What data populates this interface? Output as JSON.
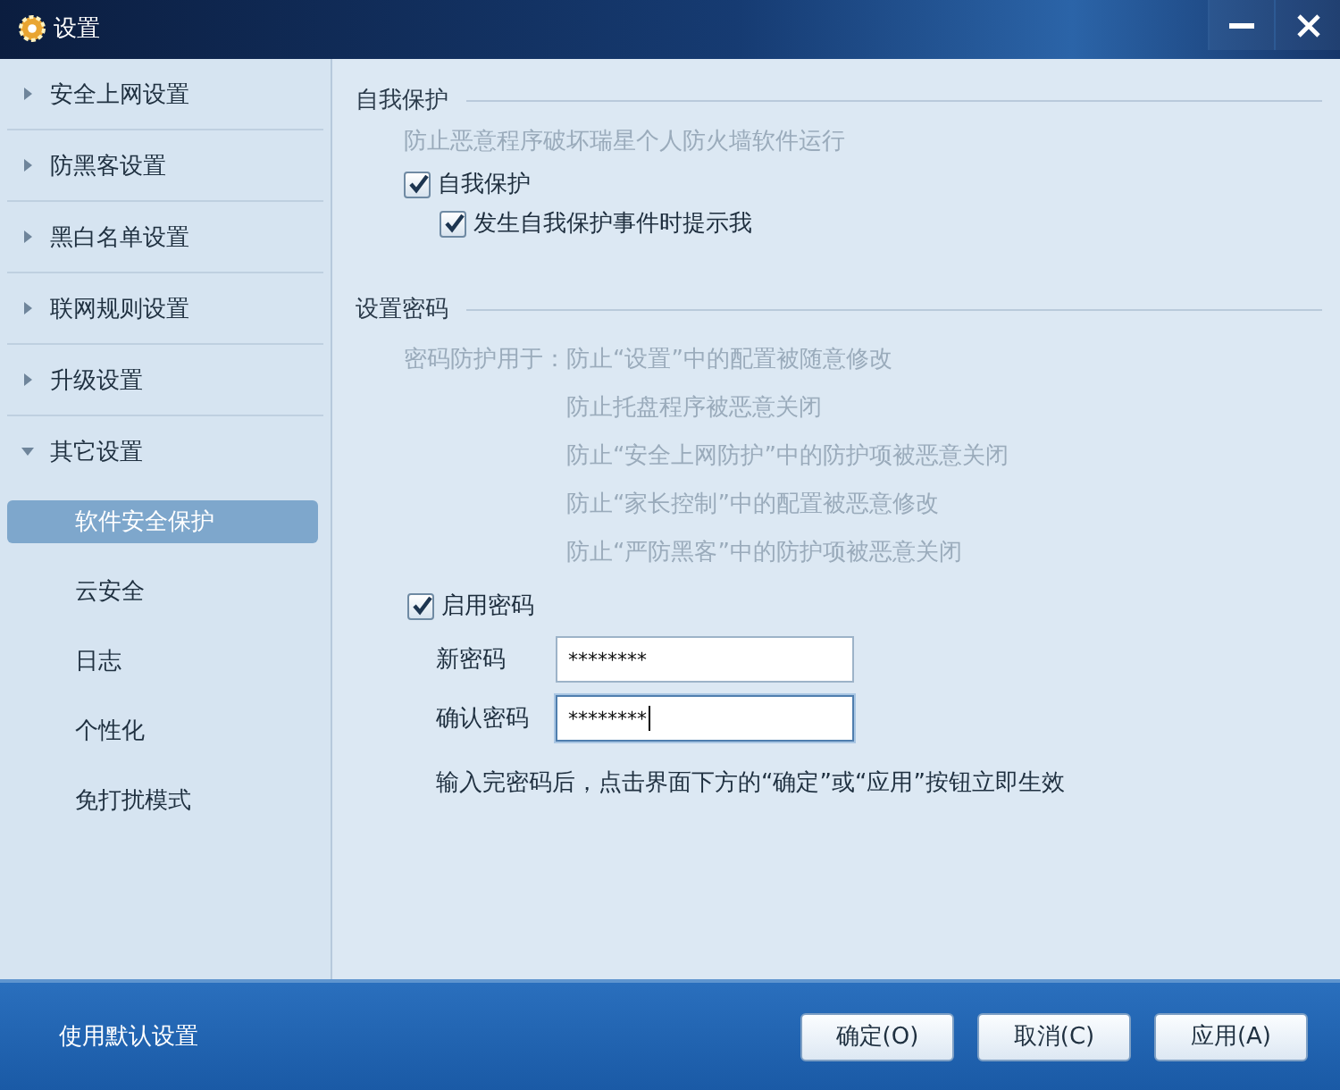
{
  "window": {
    "title": "设置"
  },
  "sidebar": {
    "items": [
      {
        "label": "安全上网设置",
        "expanded": false
      },
      {
        "label": "防黑客设置",
        "expanded": false
      },
      {
        "label": "黑白名单设置",
        "expanded": false
      },
      {
        "label": "联网规则设置",
        "expanded": false
      },
      {
        "label": "升级设置",
        "expanded": false
      },
      {
        "label": "其它设置",
        "expanded": true,
        "children": [
          {
            "label": "软件安全保护",
            "selected": true
          },
          {
            "label": "云安全",
            "selected": false
          },
          {
            "label": "日志",
            "selected": false
          },
          {
            "label": "个性化",
            "selected": false
          },
          {
            "label": "免打扰模式",
            "selected": false
          }
        ]
      }
    ]
  },
  "self_protection": {
    "title": "自我保护",
    "description": "防止恶意程序破坏瑞星个人防火墙软件运行",
    "options": [
      {
        "label": "自我保护",
        "checked": true,
        "children": [
          {
            "label": "发生自我保护事件时提示我",
            "checked": true
          }
        ]
      }
    ]
  },
  "password": {
    "title": "设置密码",
    "lead": "密码防护用于：",
    "uses": [
      "防止“设置”中的配置被随意修改",
      "防止托盘程序被恶意关闭",
      "防止“安全上网防护”中的防护项被恶意关闭",
      "防止“家长控制”中的配置被恶意修改",
      "防止“严防黑客”中的防护项被恶意关闭"
    ],
    "enable": {
      "label": "启用密码",
      "checked": true
    },
    "fields": [
      {
        "label": "新密码",
        "value": "********",
        "focused": false
      },
      {
        "label": "确认密码",
        "value": "********",
        "focused": true
      }
    ],
    "note": "输入完密码后，点击界面下方的“确定”或“应用”按钮立即生效"
  },
  "footer": {
    "reset_link": "使用默认设置",
    "buttons": [
      "确定(O)",
      "取消(C)",
      "应用(A)"
    ]
  }
}
